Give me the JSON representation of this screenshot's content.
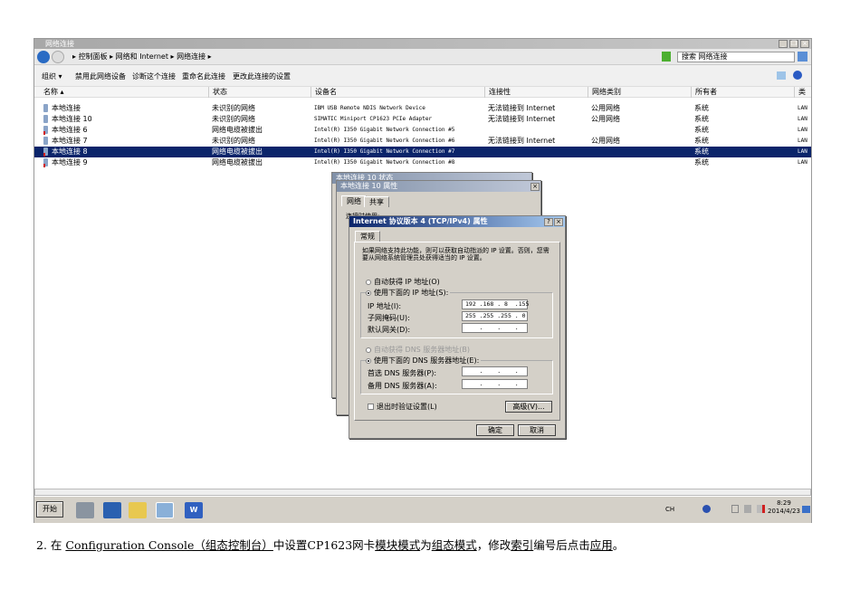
{
  "window": {
    "title": "网络连接",
    "minimize": "_",
    "maximize": "❐",
    "close": "×"
  },
  "address": {
    "breadcrumb": [
      "控制面板",
      "网络和 Internet",
      "网络连接"
    ],
    "search_placeholder": "搜索 网络连接"
  },
  "toolbar": {
    "items": [
      "组织 ▾",
      "禁用此网络设备",
      "诊断这个连接",
      "重命名此连接",
      "更改此连接的设置"
    ]
  },
  "table": {
    "columns": [
      "名称 ▴",
      "状态",
      "设备名",
      "连接性",
      "网络类别",
      "所有者",
      "类型"
    ],
    "rows": [
      {
        "name": "本地连接",
        "status": "未识别的网络",
        "device": "IBM USB Remote NDIS Network Device",
        "connectivity": "无法链接到 Internet",
        "category": "公用网络",
        "owner": "系统",
        "type": "LAN",
        "unplugged": false
      },
      {
        "name": "本地连接 10",
        "status": "未识别的网络",
        "device": "SIMATIC Miniport CP1623 PCIe Adapter",
        "connectivity": "无法链接到 Internet",
        "category": "公用网络",
        "owner": "系统",
        "type": "LAN",
        "unplugged": false
      },
      {
        "name": "本地连接 6",
        "status": "网络电缆被拔出",
        "device": "Intel(R) I350 Gigabit Network Connection #5",
        "connectivity": "",
        "category": "",
        "owner": "系统",
        "type": "LAN",
        "unplugged": true
      },
      {
        "name": "本地连接 7",
        "status": "未识别的网络",
        "device": "Intel(R) I350 Gigabit Network Connection #6",
        "connectivity": "无法链接到 Internet",
        "category": "公用网络",
        "owner": "系统",
        "type": "LAN",
        "unplugged": false
      },
      {
        "name": "本地连接 8",
        "status": "网络电缆被拔出",
        "device": "Intel(R) I350 Gigabit Network Connection #7",
        "connectivity": "",
        "category": "",
        "owner": "系统",
        "type": "LAN",
        "unplugged": true,
        "selected": true
      },
      {
        "name": "本地连接 9",
        "status": "网络电缆被拔出",
        "device": "Intel(R) I350 Gigabit Network Connection #8",
        "connectivity": "",
        "category": "",
        "owner": "系统",
        "type": "LAN",
        "unplugged": true
      }
    ]
  },
  "status_dialog": {
    "title": "本地连接 10 状态"
  },
  "props_dialog": {
    "title": "本地连接 10 属性",
    "tabs": [
      "网络",
      "共享"
    ],
    "label": "连接时使用:"
  },
  "tcp_dialog": {
    "title": "Internet 协议版本 4 (TCP/IPv4) 属性",
    "tab": "常规",
    "description": "如果网络支持此功能，则可以获取自动指派的 IP 设置。否则，您需要从网络系统管理员处获得适当的 IP 设置。",
    "auto_ip": "自动获得 IP 地址(O)",
    "manual_ip": "使用下面的 IP 地址(S):",
    "ip_label": "IP 地址(I):",
    "ip_value": "192 .168 . 8  .155",
    "mask_label": "子网掩码(U):",
    "mask_value": "255 .255 .255 . 0",
    "gateway_label": "默认网关(D):",
    "gateway_value": "    .    .    .",
    "auto_dns": "自动获得 DNS 服务器地址(B)",
    "manual_dns": "使用下面的 DNS 服务器地址(E):",
    "dns1_label": "首选 DNS 服务器(P):",
    "dns1_value": "    .    .    .",
    "dns2_label": "备用 DNS 服务器(A):",
    "dns2_value": "    .    .    .",
    "validate": "退出时验证设置(L)",
    "advanced": "高级(V)...",
    "ok": "确定",
    "cancel": "取消",
    "help": "?",
    "close": "×"
  },
  "taskbar": {
    "start": "开始",
    "lang": "CH",
    "time": "8:29",
    "date": "2014/4/23"
  },
  "caption": {
    "p1": "2. 在 ",
    "u1": "Configuration Console（组态控制台）",
    "p2": "中设置CP1623网卡",
    "u2": "模块模式",
    "p3": "为",
    "u3": "组态模式",
    "p4": "，修改",
    "u4": "索引",
    "p5": "编号后点击",
    "u5": "应用",
    "p6": "。"
  }
}
